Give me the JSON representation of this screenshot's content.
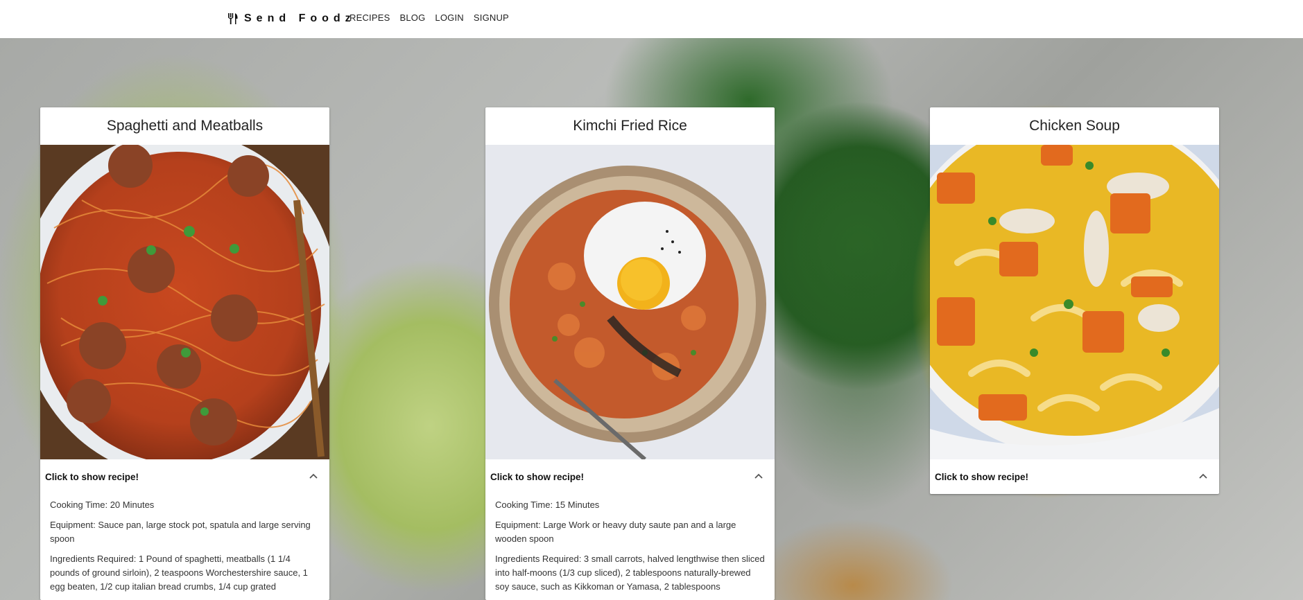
{
  "header": {
    "brand_name": "Send Foodz",
    "brand_icon": "fork-knife-icon",
    "nav": [
      {
        "label": "RECIPES"
      },
      {
        "label": "BLOG"
      },
      {
        "label": "LOGIN"
      },
      {
        "label": "SIGNUP"
      }
    ]
  },
  "cards": [
    {
      "title": "Spaghetti and Meatballs",
      "toggle_label": "Click to show recipe!",
      "toggle_icon": "chevron-up-icon",
      "expanded": true,
      "cooking_time": "Cooking Time: 20 Minutes",
      "equipment": "Equipment: Sauce pan, large stock pot, spatula and large serving spoon",
      "ingredients": "Ingredients Required: 1 Pound of spaghetti, meatballs (1 1/4 pounds of ground sirloin), 2 teaspoons Worchestershire sauce, 1 egg beaten, 1/2 cup italian bread crumbs, 1/4 cup grated"
    },
    {
      "title": "Kimchi Fried Rice",
      "toggle_label": "Click to show recipe!",
      "toggle_icon": "chevron-up-icon",
      "expanded": true,
      "cooking_time": "Cooking Time: 15 Minutes",
      "equipment": "Equipment: Large Work or heavy duty saute pan and a large wooden spoon",
      "ingredients": "Ingredients Required: 3 small carrots, halved lengthwise then sliced into half-moons (1/3 cup sliced), 2 tablespoons naturally-brewed soy sauce, such as Kikkoman or Yamasa, 2 tablespoons"
    },
    {
      "title": "Chicken Soup",
      "toggle_label": "Click to show recipe!",
      "toggle_icon": "chevron-up-icon",
      "expanded": false
    }
  ],
  "colors": {
    "header_bg": "#ffffff",
    "card_bg": "#ffffff",
    "text": "#222222"
  }
}
